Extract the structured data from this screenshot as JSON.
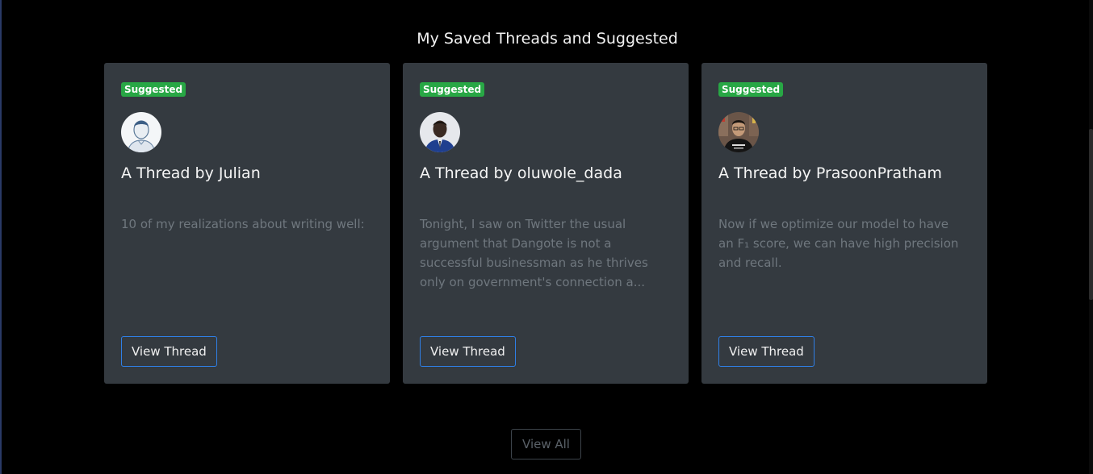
{
  "section": {
    "title": "My Saved Threads and Suggested"
  },
  "cards": [
    {
      "badge": "Suggested",
      "title": "A Thread by Julian",
      "text": "10 of my realizations about writing well:",
      "button": "View Thread",
      "avatar_icon": "user-avatar-julian"
    },
    {
      "badge": "Suggested",
      "title": "A Thread by oluwole_dada",
      "text": "Tonight, I saw on Twitter the usual argument that Dangote is not a successful businessman as he thrives only on government's connection a...",
      "button": "View Thread",
      "avatar_icon": "user-avatar-oluwole"
    },
    {
      "badge": "Suggested",
      "title": "A Thread by PrasoonPratham",
      "text": "Now if we optimize our model to have an F₁ score, we can have high precision and recall.",
      "button": "View Thread",
      "avatar_icon": "user-avatar-prasoon"
    }
  ],
  "footer": {
    "view_all": "View All"
  },
  "colors": {
    "badge": "#28a745",
    "card_bg": "#343a40",
    "button_border": "#2f7fe6"
  }
}
